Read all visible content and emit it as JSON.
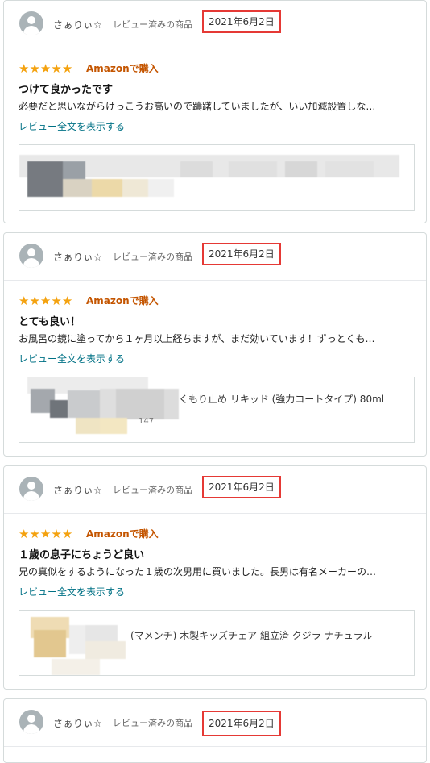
{
  "reviews": [
    {
      "user_name": "さぁりぃ☆",
      "reviewed_label": "レビュー済みの商品",
      "date": "2021年6月2日",
      "rating": 5,
      "verified": "Amazonで購入",
      "title": "つけて良かったです",
      "text": "必要だと思いながらけっこうお高いので躊躇していましたが、いい加減設置しな…",
      "read_more": "レビュー全文を表示する",
      "product_name": "",
      "product_sub": ""
    },
    {
      "user_name": "さぁりぃ☆",
      "reviewed_label": "レビュー済みの商品",
      "date": "2021年6月2日",
      "rating": 5,
      "verified": "Amazonで購入",
      "title": "とても良い！",
      "text": "お風呂の鏡に塗ってから１ヶ月以上経ちますが、まだ効いています！ずっとくも…",
      "read_more": "レビュー全文を表示する",
      "product_name": "くもり止め リキッド (強力コートタイプ) 80ml",
      "product_sub": "147"
    },
    {
      "user_name": "さぁりぃ☆",
      "reviewed_label": "レビュー済みの商品",
      "date": "2021年6月2日",
      "rating": 5,
      "verified": "Amazonで購入",
      "title": "１歳の息子にちょうど良い",
      "text": "兄の真似をするようになった１歳の次男用に買いました。長男は有名メーカーの…",
      "read_more": "レビュー全文を表示する",
      "product_name": "(マメンチ) 木製キッズチェア 組立済 クジラ ナチュラル",
      "product_sub": ""
    },
    {
      "user_name": "さぁりぃ☆",
      "reviewed_label": "レビュー済みの商品",
      "date": "2021年6月2日"
    }
  ],
  "colors": {
    "star": "#f4a20f",
    "verified": "#c45500",
    "link": "#007185",
    "highlight_box": "#e53935"
  }
}
